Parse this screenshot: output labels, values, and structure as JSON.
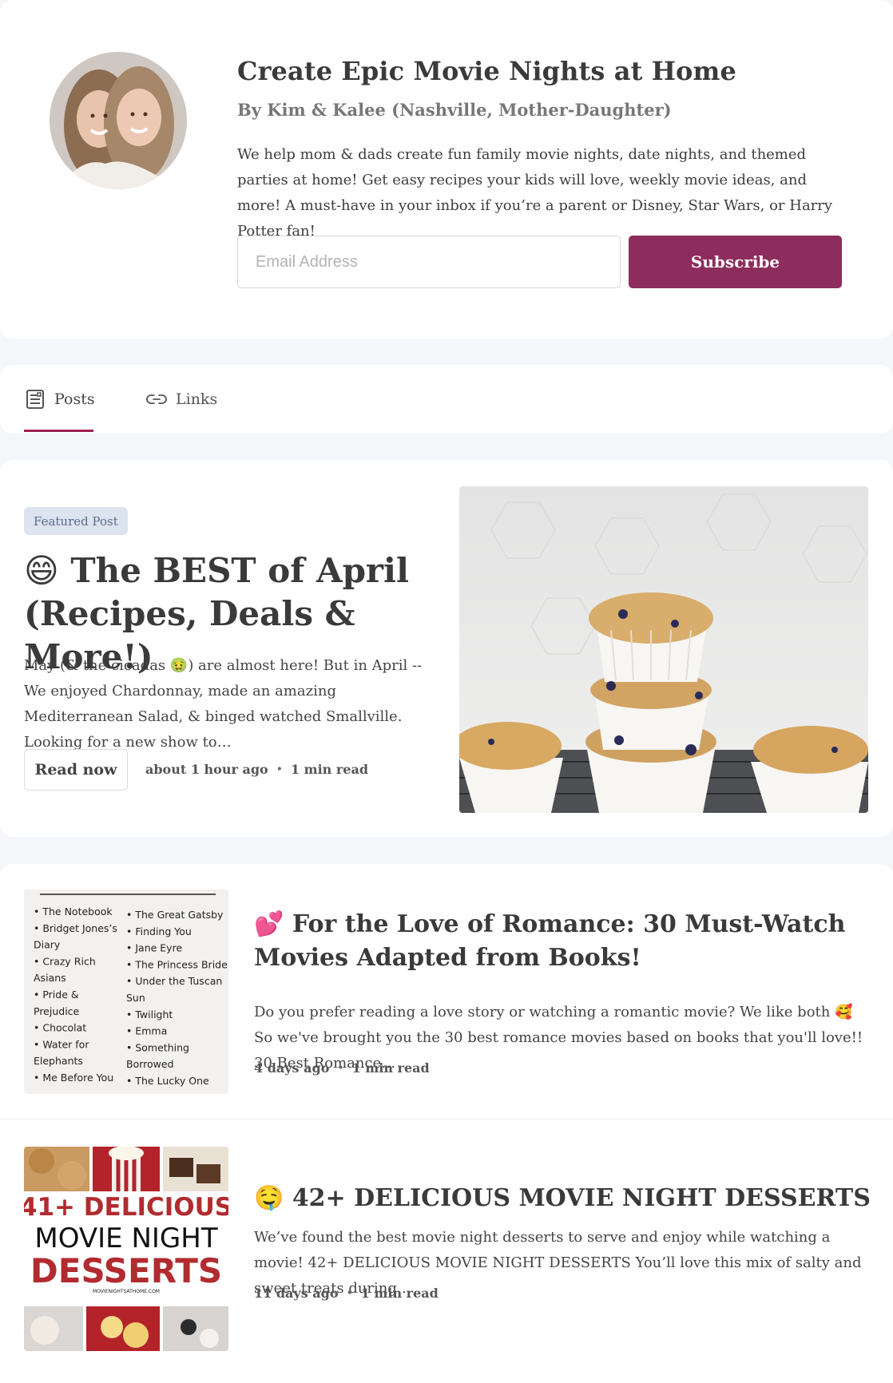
{
  "header": {
    "title": "Create Epic Movie Nights at Home",
    "byline": "By Kim & Kalee (Nashville, Mother-Daughter)",
    "description": "We help mom & dads create fun family movie nights, date nights, and themed parties at home! Get easy recipes your kids will love, weekly movie ideas, and more! A must-have in your inbox if you’re a parent or Disney, Star Wars, or Harry Potter fan!",
    "email_placeholder": "Email Address",
    "subscribe_label": "Subscribe"
  },
  "tabs": {
    "posts_label": "Posts",
    "links_label": "Links",
    "active": "Posts"
  },
  "featured": {
    "badge": "Featured Post",
    "emoji": "😄",
    "title": "The BEST of April (Recipes, Deals & More!)",
    "excerpt_before": "May (& the cicadas ",
    "excerpt_emoji": "🤢",
    "excerpt_after": ") are almost here! But in April -- We enjoyed Chardonnay, made an amazing Mediterranean Salad, & binged watched Smallville. Looking for a new show to…",
    "read_now_label": "Read now",
    "time": "about 1 hour ago",
    "read_time": "1 min read"
  },
  "posts": [
    {
      "emoji": "💕",
      "title": "For the Love of Romance: 30 Must-Watch Movies Adapted from Books!",
      "excerpt_before": "Do you prefer reading a love story or watching a romantic movie? We like both ",
      "excerpt_emoji": "🥰",
      "excerpt_after": " So we've brought you the 30 best romance movies based on books that you'll love!! 30 Best Romance…",
      "time": "4 days ago",
      "read_time": "1 min read",
      "thumb_list_left": [
        "• The Notebook",
        "• Bridget Jones’s",
        "   Diary",
        "• Crazy Rich",
        "   Asians",
        "• Pride &",
        "   Prejudice",
        "• Chocolat",
        "• Water for",
        "   Elephants",
        "• Me Before You"
      ],
      "thumb_list_right": [
        "• The Great Gatsby",
        "• Finding You",
        "• Jane Eyre",
        "• The Princess Bride",
        "• Under the Tuscan",
        "   Sun",
        "• Twilight",
        "• Emma",
        "• Something",
        "   Borrowed",
        "• The Lucky One"
      ]
    },
    {
      "emoji": "🤤",
      "title": "42+ DELICIOUS MOVIE NIGHT DESSERTS",
      "excerpt": "We’ve found the best movie night desserts to serve and enjoy while watching a movie! 42+ DELICIOUS MOVIE NIGHT DESSERTS You’ll love this mix of salty and sweet treats during…",
      "time": "11 days ago",
      "read_time": "1 min read",
      "thumb_line1": "41+ DELICIOUS",
      "thumb_line2": "MOVIE NIGHT",
      "thumb_line3": "DESSERTS",
      "thumb_site": "MOVIENIGHTSATHOME.COM"
    }
  ],
  "meta_separator": "•",
  "colors": {
    "accent": "#8d2d5d",
    "tab_underline": "#a02051",
    "badge_bg": "#dde3ef",
    "page_bg": "#f5f6f9"
  },
  "icons": {
    "posts_tab": "document-icon",
    "links_tab": "link-icon"
  }
}
